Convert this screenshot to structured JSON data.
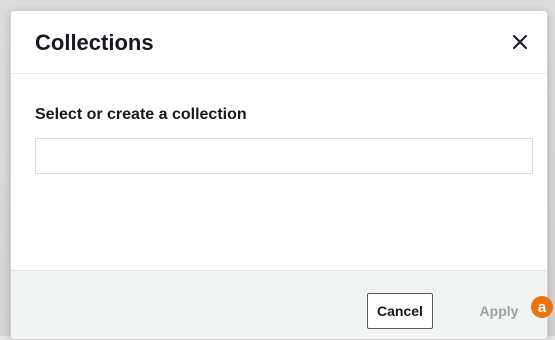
{
  "dialog": {
    "title": "Collections",
    "close_icon": "close-icon",
    "field_label": "Select or create a collection",
    "input_value": "",
    "input_placeholder": "",
    "cancel_label": "Cancel",
    "apply_label": "Apply"
  },
  "badge": {
    "label": "a",
    "color": "#e8750f"
  }
}
